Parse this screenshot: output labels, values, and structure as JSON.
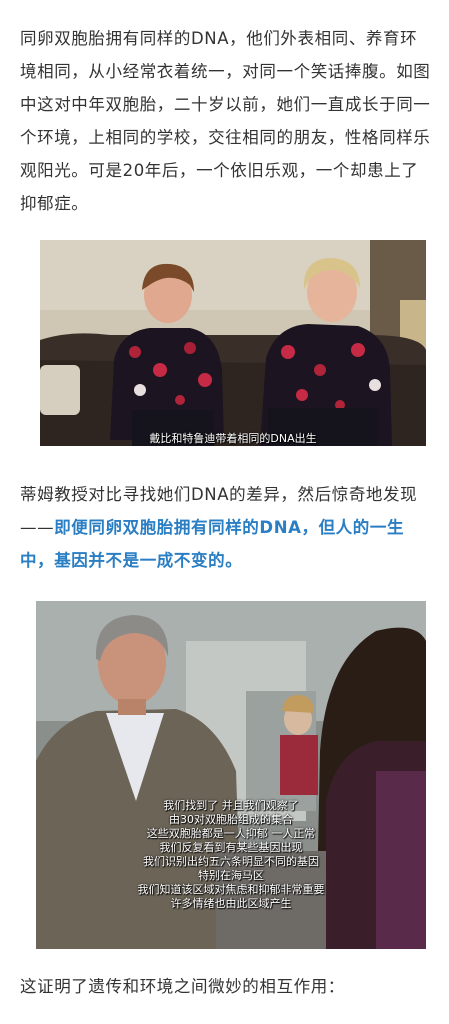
{
  "paragraph1": "同卵双胞胎拥有同样的DNA，他们外表相同、养育环境相同，从小经常衣着统一，对同一个笑话捧腹。如图中这对中年双胞胎，二十岁以前，她们一直成长于同一个环境，上相同的学校，交往相同的朋友，性格同样乐观阳光。可是20年后，一个依旧乐观，一个却患上了抑郁症。",
  "image1": {
    "caption": "戴比和特鲁迪带着相同的DNA出生"
  },
  "paragraph2": {
    "normal": "蒂姆教授对比寻找她们DNA的差异，然后惊奇地发现——",
    "highlight": "即便同卵双胞胎拥有同样的DNA，但人的一生中，基因并不是一成不变的。"
  },
  "image2": {
    "subtitles": [
      "我们找到了 并且我们观察了",
      "由30对双胞胎组成的集合",
      "这些双胞胎都是一人抑郁 一人正常",
      "我们反复看到有某些基因出现",
      "我们识别出约五六条明显不同的基因",
      "特别在海马区",
      "我们知道该区域对焦虑和抑郁非常重要",
      "许多情绪也由此区域产生"
    ]
  },
  "paragraph3": "这证明了遗传和环境之间微妙的相互作用："
}
